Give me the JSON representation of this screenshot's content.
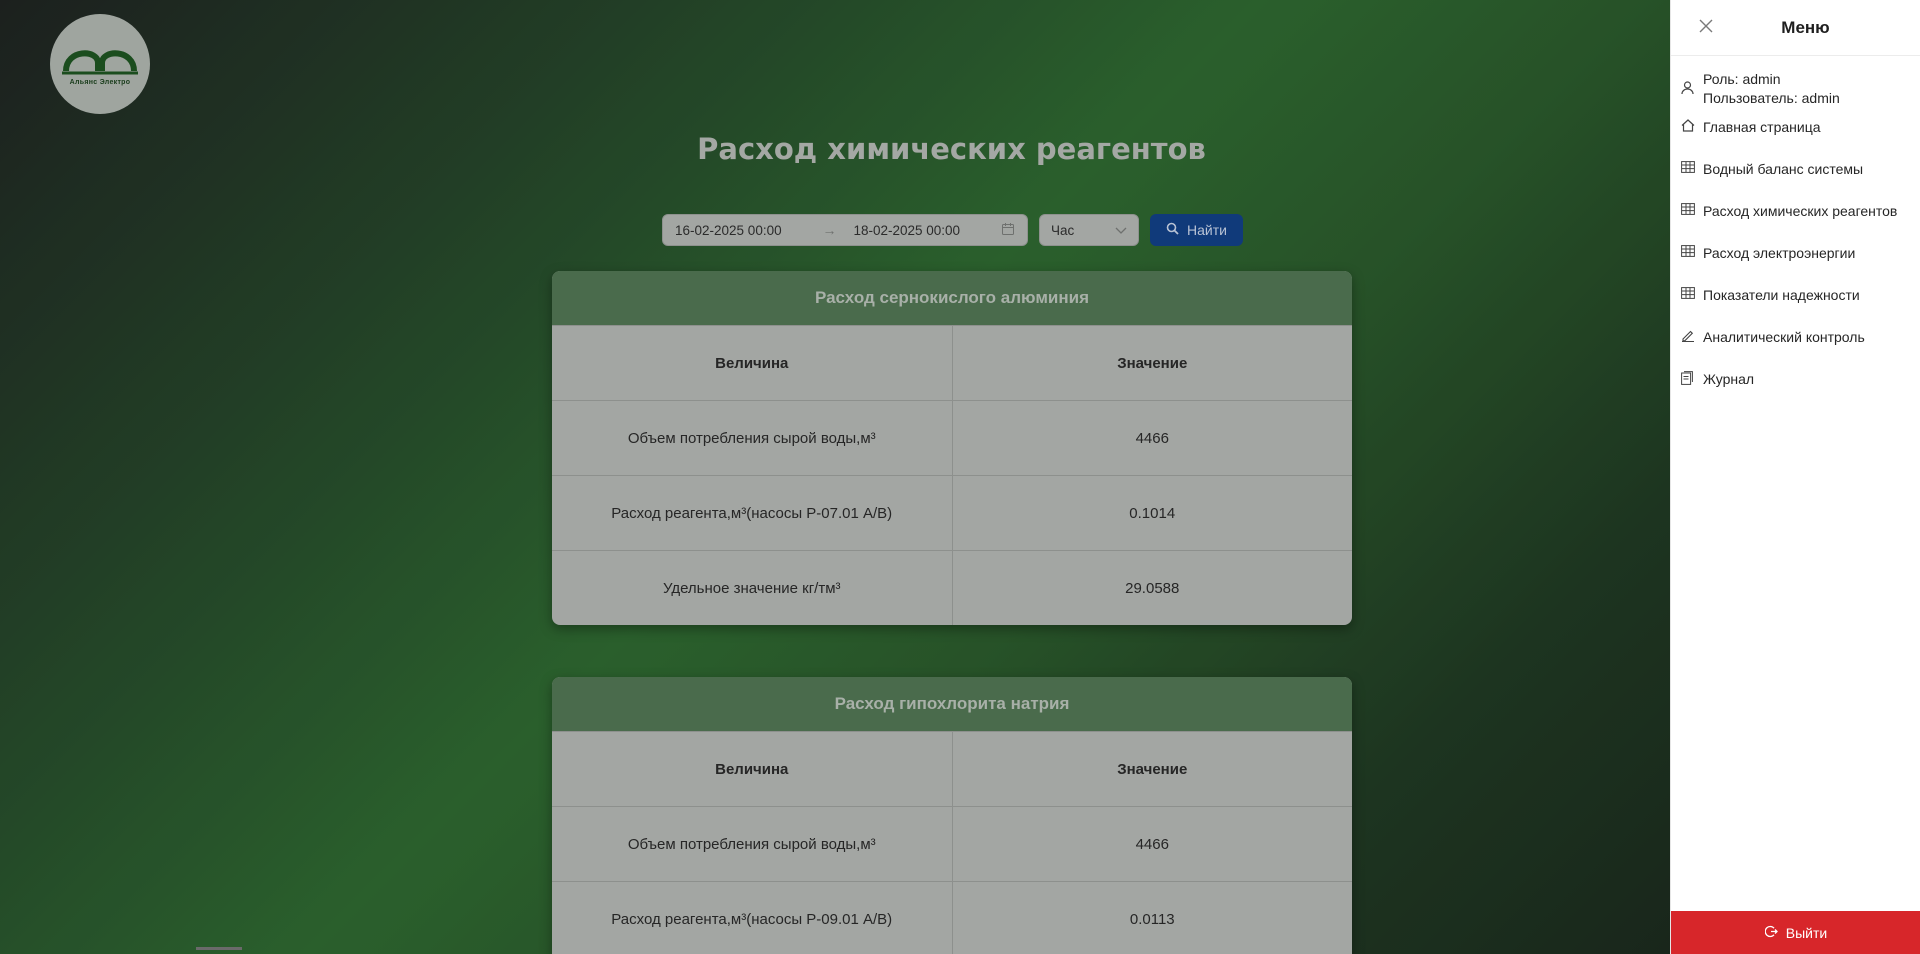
{
  "logo": {
    "caption": "Альянс Электро"
  },
  "page_title": "Расход химических реагентов",
  "filters": {
    "date_from": "16-02-2025 00:00",
    "date_to": "18-02-2025 00:00",
    "interval": "Час",
    "find_label": "Найти"
  },
  "tables": [
    {
      "title": "Расход сернокислого алюминия",
      "header": [
        "Величина",
        "Значение"
      ],
      "rows": [
        [
          "Объем потребления сырой воды,м³",
          "4466"
        ],
        [
          "Расход реагента,м³(насосы Р-07.01 А/В)",
          "0.1014"
        ],
        [
          "Удельное значение кг/тм³",
          "29.0588"
        ]
      ]
    },
    {
      "title": "Расход гипохлорита натрия",
      "header": [
        "Величина",
        "Значение"
      ],
      "rows": [
        [
          "Объем потребления сырой воды,м³",
          "4466"
        ],
        [
          "Расход реагента,м³(насосы Р-09.01 А/В)",
          "0.0113"
        ]
      ]
    }
  ],
  "menu": {
    "title": "Меню",
    "role": "Роль: admin",
    "user": "Пользователь: admin",
    "items": [
      {
        "label": "Главная страница",
        "icon": "home-icon"
      },
      {
        "label": "Водный баланс системы",
        "icon": "table-icon"
      },
      {
        "label": "Расход химических реагентов",
        "icon": "table-icon"
      },
      {
        "label": "Расход электроэнергии",
        "icon": "table-icon"
      },
      {
        "label": "Показатели надежности",
        "icon": "table-icon"
      },
      {
        "label": "Аналитический контроль",
        "icon": "edit-icon"
      },
      {
        "label": "Журнал",
        "icon": "journal-icon"
      }
    ],
    "logout_label": "Выйти"
  },
  "colors": {
    "accent_button": "#103a7a",
    "logout": "#d7262a",
    "card_header": "#4a6b4c"
  }
}
